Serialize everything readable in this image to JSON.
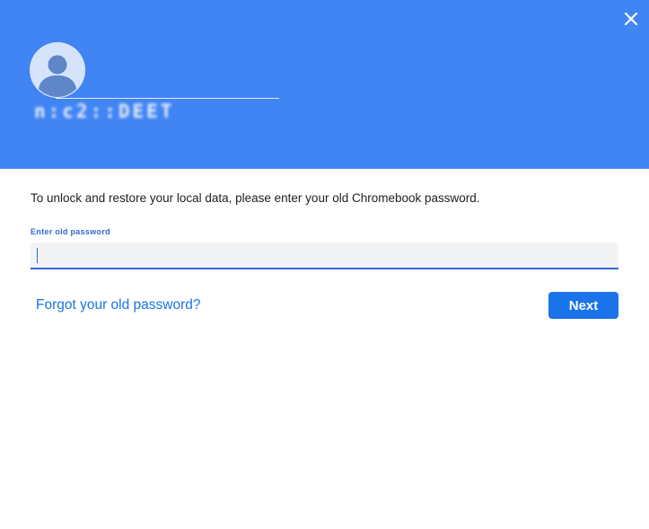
{
  "header": {
    "background_color": "#4184f3",
    "close_icon": "close-icon",
    "avatar_icon": "account-icon",
    "username": "n:c2::DEET"
  },
  "main": {
    "prompt": "To unlock and restore your local data, please enter your old Chromebook password.",
    "password_field": {
      "label": "Enter old password",
      "value": "",
      "placeholder": ""
    },
    "forgot_link": "Forgot your old password?",
    "next_button": "Next"
  },
  "colors": {
    "accent": "#1a73e8",
    "field_underline": "#3367d6",
    "text": "#212121"
  }
}
